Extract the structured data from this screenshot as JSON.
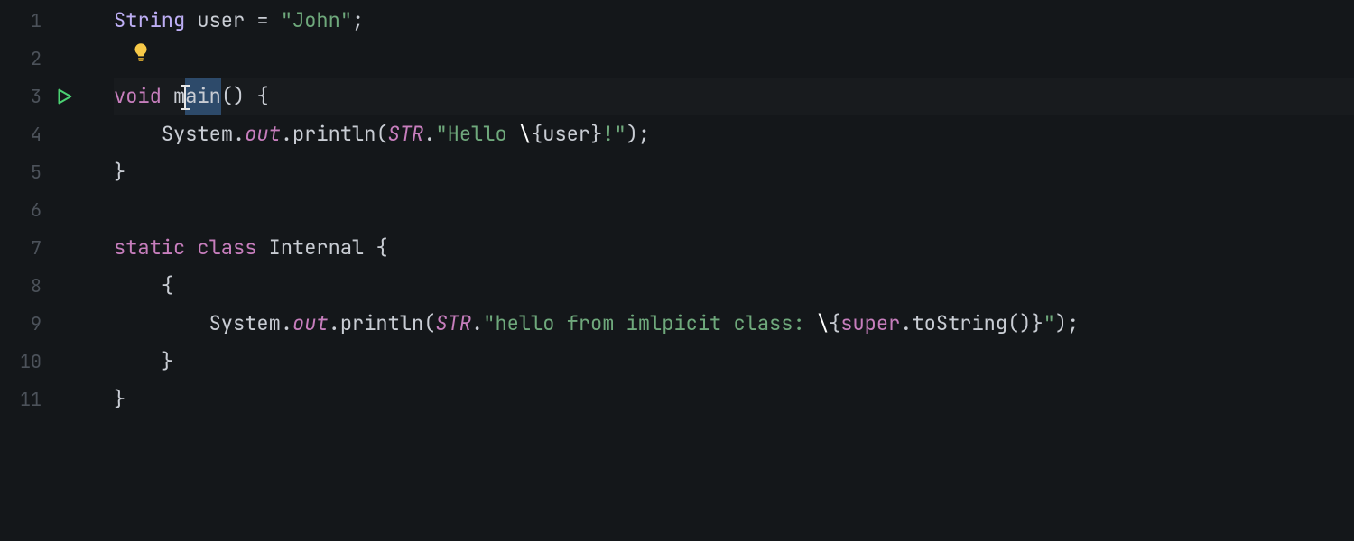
{
  "colors": {
    "background": "#14171a",
    "gutter_border": "#2a2d31",
    "lineno": "#4c525a",
    "default": "#c9cdd4",
    "keyword": "#c77ebd",
    "type": "#bdaef4",
    "string": "#6fa97c",
    "selection": "#2d4a6a",
    "run_icon": "#4bd173",
    "bulb": "#f7c948"
  },
  "gutter": {
    "line_numbers": [
      "1",
      "2",
      "3",
      "4",
      "5",
      "6",
      "7",
      "8",
      "9",
      "10",
      "11"
    ],
    "run_icon_line": 3,
    "lightbulb_line": 2
  },
  "cursor": {
    "line": 3,
    "after_token_index": 4
  },
  "selection": {
    "line": 3,
    "text": "main"
  },
  "code_lines": [
    {
      "n": 1,
      "indent": 0,
      "tokens": [
        {
          "t": "String",
          "c": "type"
        },
        {
          "t": " ",
          "c": "punct"
        },
        {
          "t": "user",
          "c": "ident"
        },
        {
          "t": " ",
          "c": "punct"
        },
        {
          "t": "=",
          "c": "punct"
        },
        {
          "t": " ",
          "c": "punct"
        },
        {
          "t": "\"John\"",
          "c": "str"
        },
        {
          "t": ";",
          "c": "punct"
        }
      ]
    },
    {
      "n": 2,
      "indent": 0,
      "tokens": []
    },
    {
      "n": 3,
      "indent": 0,
      "current": true,
      "tokens": [
        {
          "t": "void",
          "c": "kw"
        },
        {
          "t": " ",
          "c": "punct"
        },
        {
          "t": "m",
          "c": "ident"
        },
        {
          "t": "ain",
          "c": "ident",
          "sel": true
        },
        {
          "t": "()",
          "c": "punct"
        },
        {
          "t": " ",
          "c": "punct"
        },
        {
          "t": "{",
          "c": "brace"
        }
      ]
    },
    {
      "n": 4,
      "indent": 1,
      "tokens": [
        {
          "t": "System",
          "c": "ident"
        },
        {
          "t": ".",
          "c": "punct"
        },
        {
          "t": "out",
          "c": "staticf"
        },
        {
          "t": ".",
          "c": "punct"
        },
        {
          "t": "println",
          "c": "method"
        },
        {
          "t": "(",
          "c": "punct"
        },
        {
          "t": "STR",
          "c": "tmpl italic"
        },
        {
          "t": ".",
          "c": "punct"
        },
        {
          "t": "\"Hello ",
          "c": "str"
        },
        {
          "t": "\\",
          "c": "escape"
        },
        {
          "t": "{",
          "c": "brace"
        },
        {
          "t": "user",
          "c": "ident"
        },
        {
          "t": "}",
          "c": "brace"
        },
        {
          "t": "!\"",
          "c": "str"
        },
        {
          "t": ")",
          "c": "punct"
        },
        {
          "t": ";",
          "c": "punct"
        }
      ]
    },
    {
      "n": 5,
      "indent": 0,
      "tokens": [
        {
          "t": "}",
          "c": "brace"
        }
      ]
    },
    {
      "n": 6,
      "indent": 0,
      "tokens": []
    },
    {
      "n": 7,
      "indent": 0,
      "tokens": [
        {
          "t": "static",
          "c": "kw"
        },
        {
          "t": " ",
          "c": "punct"
        },
        {
          "t": "class",
          "c": "kw"
        },
        {
          "t": " ",
          "c": "punct"
        },
        {
          "t": "Internal",
          "c": "ident"
        },
        {
          "t": " ",
          "c": "punct"
        },
        {
          "t": "{",
          "c": "brace"
        }
      ]
    },
    {
      "n": 8,
      "indent": 1,
      "tokens": [
        {
          "t": "{",
          "c": "brace"
        }
      ]
    },
    {
      "n": 9,
      "indent": 2,
      "tokens": [
        {
          "t": "System",
          "c": "ident"
        },
        {
          "t": ".",
          "c": "punct"
        },
        {
          "t": "out",
          "c": "staticf"
        },
        {
          "t": ".",
          "c": "punct"
        },
        {
          "t": "println",
          "c": "method"
        },
        {
          "t": "(",
          "c": "punct"
        },
        {
          "t": "STR",
          "c": "tmpl italic"
        },
        {
          "t": ".",
          "c": "punct"
        },
        {
          "t": "\"hello from imlpicit class: ",
          "c": "str"
        },
        {
          "t": "\\",
          "c": "escape"
        },
        {
          "t": "{",
          "c": "brace"
        },
        {
          "t": "super",
          "c": "kw"
        },
        {
          "t": ".",
          "c": "punct"
        },
        {
          "t": "toString",
          "c": "method"
        },
        {
          "t": "()",
          "c": "punct"
        },
        {
          "t": "}",
          "c": "brace"
        },
        {
          "t": "\"",
          "c": "str"
        },
        {
          "t": ")",
          "c": "punct"
        },
        {
          "t": ";",
          "c": "punct"
        }
      ]
    },
    {
      "n": 10,
      "indent": 1,
      "tokens": [
        {
          "t": "}",
          "c": "brace"
        }
      ]
    },
    {
      "n": 11,
      "indent": 0,
      "tokens": [
        {
          "t": "}",
          "c": "brace"
        }
      ]
    }
  ]
}
